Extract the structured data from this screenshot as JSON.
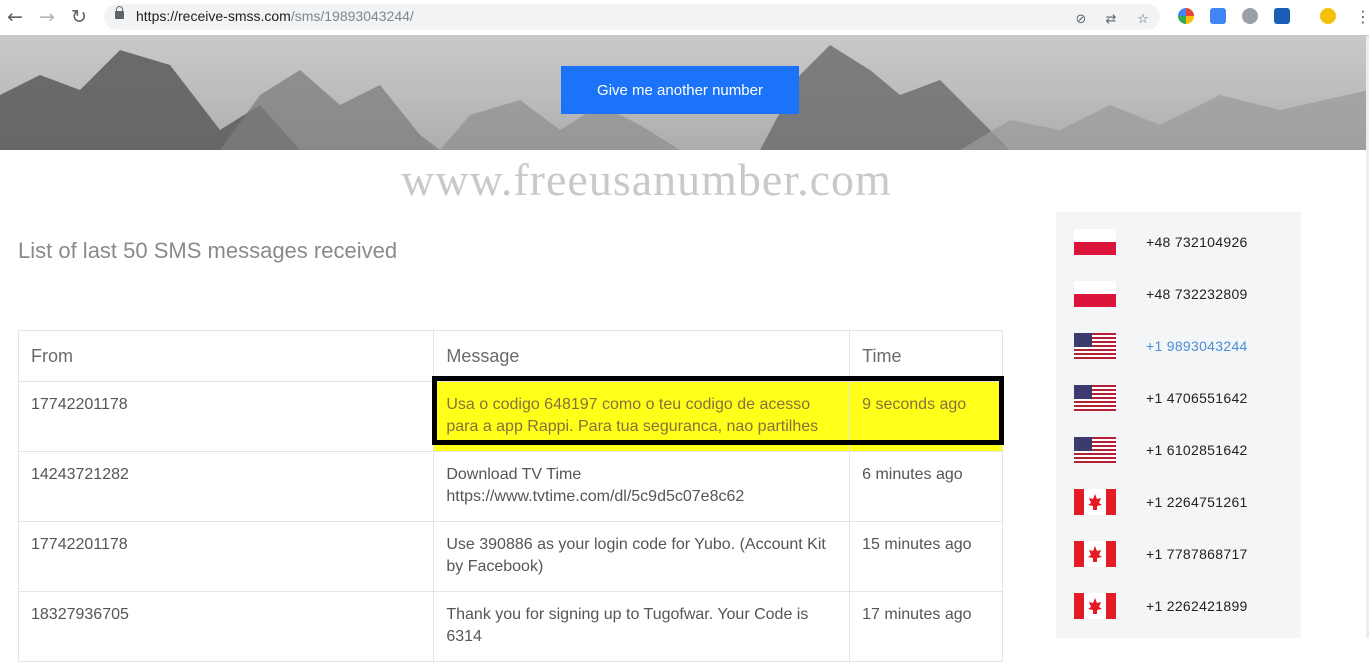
{
  "browser": {
    "url_host": "https://receive-smss.com",
    "url_path": "/sms/19893043244/"
  },
  "hero": {
    "button_label": "Give me another number"
  },
  "watermark": "www.freeusanumber.com",
  "list_title": "List of last 50 SMS messages received",
  "table": {
    "headers": [
      "From",
      "Message",
      "Time"
    ],
    "rows": [
      {
        "from": "17742201178",
        "message": "Usa o codigo 648197 como o teu codigo de acesso para a app Rappi. Para tua seguranca, nao partilhes",
        "time": "9 seconds ago",
        "highlighted": true
      },
      {
        "from": "14243721282",
        "message": "Download TV Time https://www.tvtime.com/dl/5c9d5c07e8c62",
        "time": "6 minutes ago"
      },
      {
        "from": "17742201178",
        "message": "Use 390886 as your login code for Yubo. (Account Kit by Facebook)",
        "time": "15 minutes ago"
      },
      {
        "from": "18327936705",
        "message": "Thank you for signing up to Tugofwar. Your Code is 6314",
        "time": "17 minutes ago"
      }
    ]
  },
  "sidebar": {
    "numbers": [
      {
        "flag": "poland-flag",
        "number": "+48 732104926"
      },
      {
        "flag": "poland-flag",
        "number": "+48 732232809"
      },
      {
        "flag": "usa-flag",
        "number": "+1 9893043244",
        "active": true
      },
      {
        "flag": "usa-flag",
        "number": "+1 4706551642"
      },
      {
        "flag": "usa-flag",
        "number": "+1 6102851642"
      },
      {
        "flag": "canada-flag",
        "number": "+1 2264751261"
      },
      {
        "flag": "canada-flag",
        "number": "+1 7787868717"
      },
      {
        "flag": "canada-flag",
        "number": "+1 2262421899"
      }
    ]
  },
  "colors": {
    "button_blue": "#1a73f8",
    "highlight_yellow": "#ffff1a",
    "active_number": "#4a8fd8"
  }
}
